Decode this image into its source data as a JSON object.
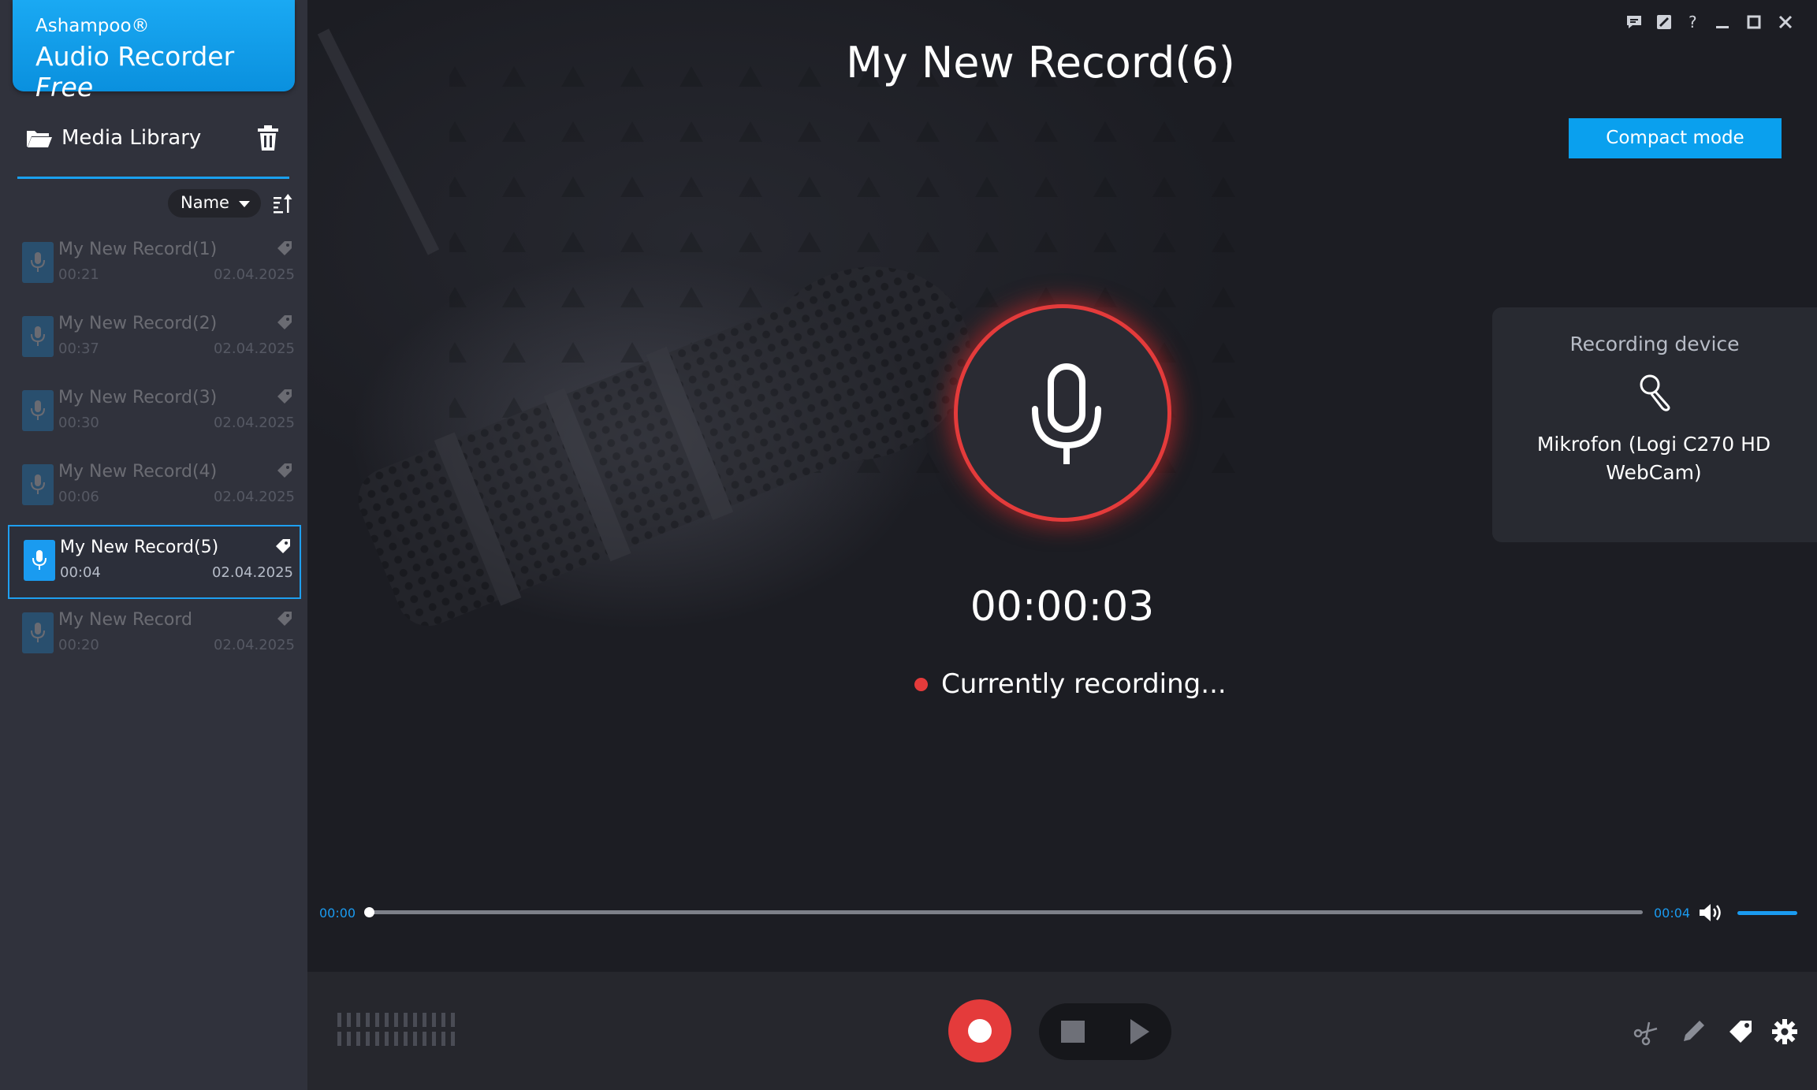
{
  "app": {
    "brand": "Ashampoo®",
    "product": "Audio Recorder",
    "edition": "Free"
  },
  "sidebar": {
    "library_title": "Media Library",
    "sort": {
      "selected": "Name"
    },
    "items": [
      {
        "name": "My New Record(1)",
        "duration": "00:21",
        "date": "02.04.2025",
        "selected": false
      },
      {
        "name": "My New Record(2)",
        "duration": "00:37",
        "date": "02.04.2025",
        "selected": false
      },
      {
        "name": "My New Record(3)",
        "duration": "00:30",
        "date": "02.04.2025",
        "selected": false
      },
      {
        "name": "My New Record(4)",
        "duration": "00:06",
        "date": "02.04.2025",
        "selected": false
      },
      {
        "name": "My New Record(5)",
        "duration": "00:04",
        "date": "02.04.2025",
        "selected": true
      },
      {
        "name": "My New Record",
        "duration": "00:20",
        "date": "02.04.2025",
        "selected": false
      }
    ]
  },
  "main": {
    "title": "My New Record(6)",
    "compact_mode_label": "Compact mode",
    "timer": "00:00:03",
    "status": "Currently recording...",
    "device": {
      "label": "Recording device",
      "name": "Mikrofon (Logi C270 HD WebCam)"
    }
  },
  "player": {
    "time_start": "00:00",
    "time_end": "00:04",
    "progress": 0.0,
    "volume": 1.0
  },
  "icons": {
    "window": [
      "feedback-icon",
      "notes-icon",
      "help-icon",
      "minimize-icon",
      "maximize-icon",
      "close-icon"
    ],
    "tools": [
      "cut-icon",
      "edit-icon",
      "tag-icon",
      "settings-icon"
    ]
  },
  "colors": {
    "accent": "#1a9bf0",
    "record": "#e43b3b",
    "sidebar_bg": "#30323c",
    "main_bg": "#1c1d23"
  }
}
